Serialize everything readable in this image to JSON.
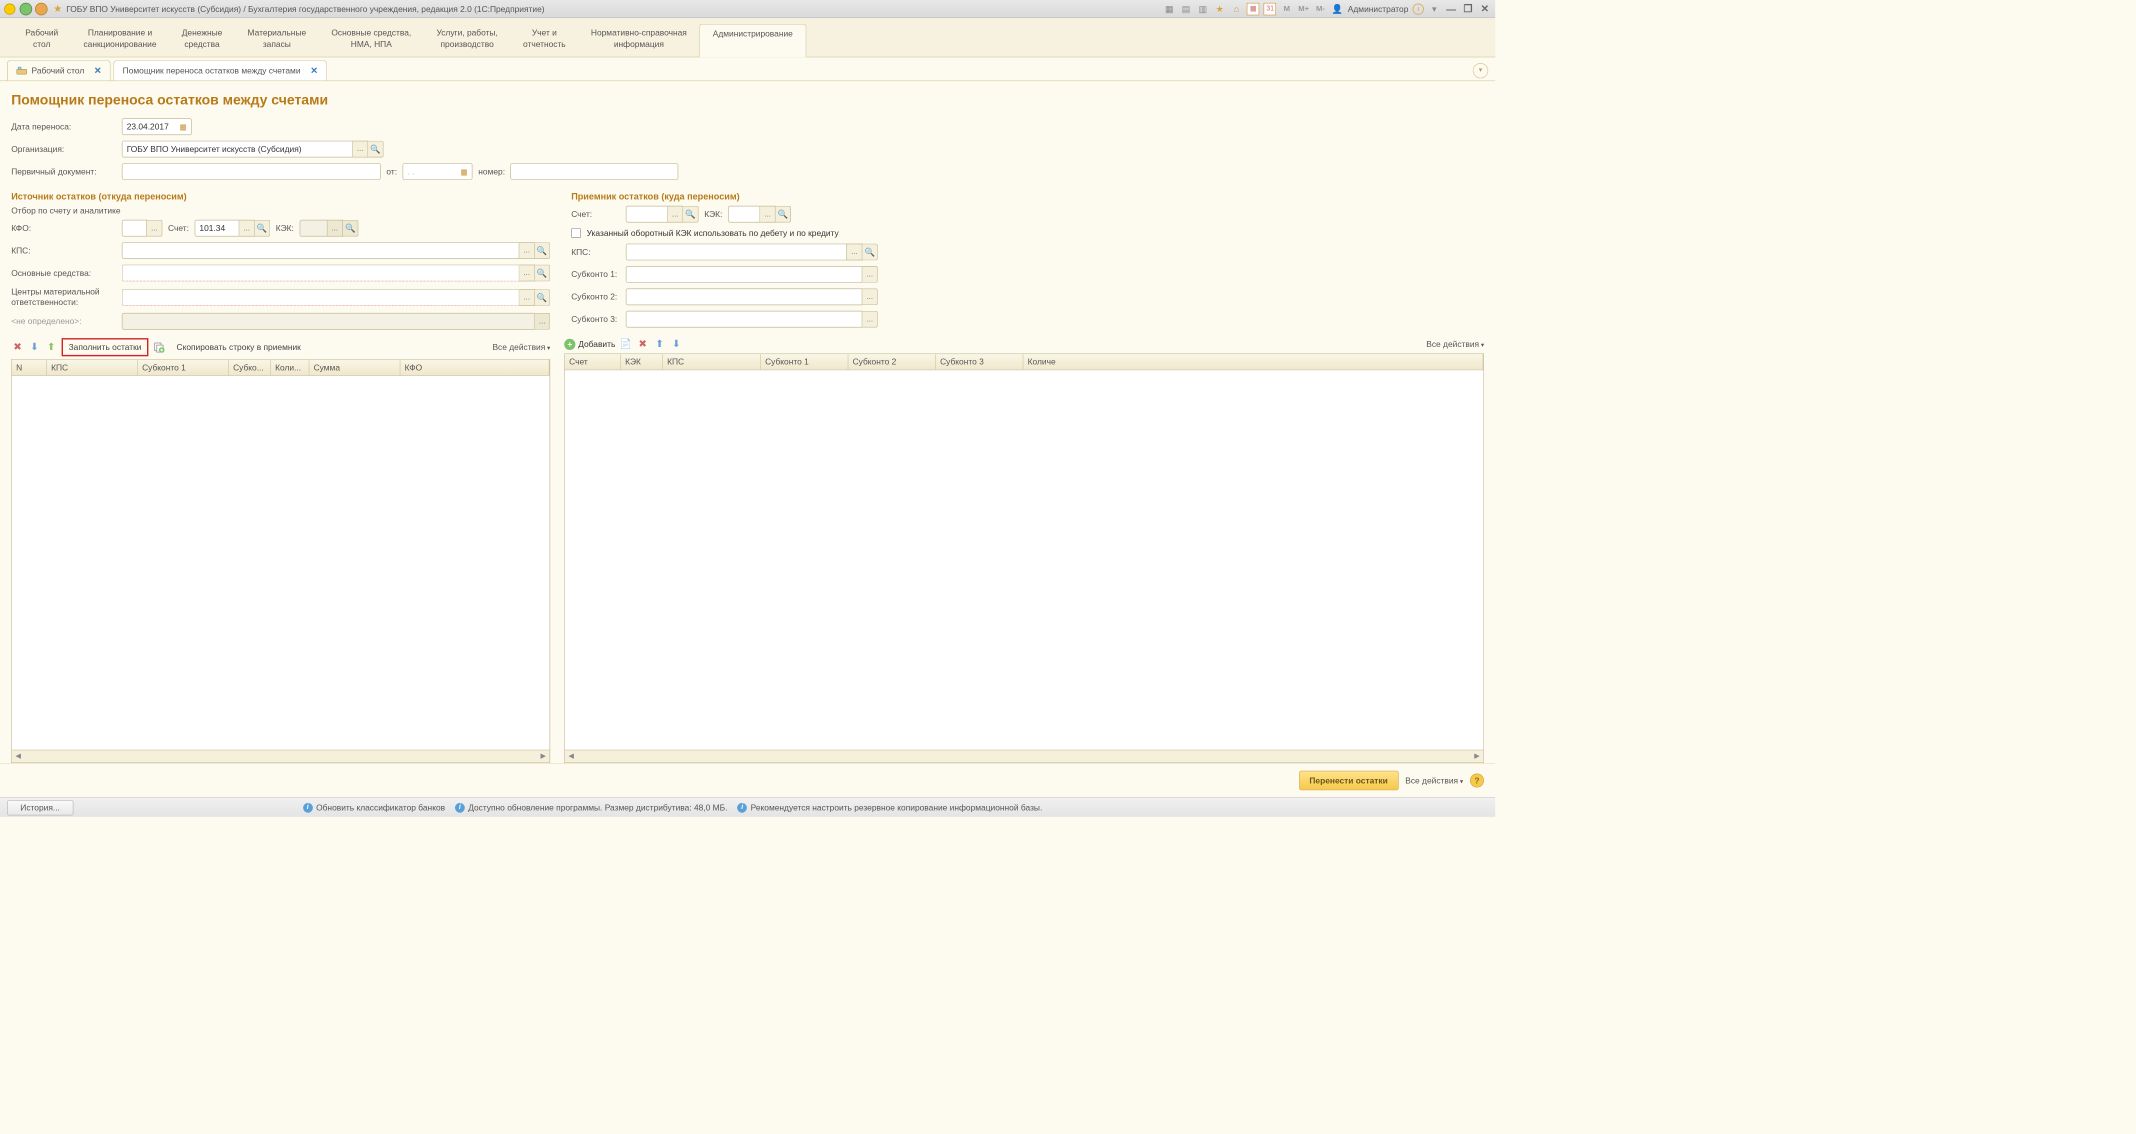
{
  "title_bar": {
    "app_title": "ГОБУ ВПО Университет искусств (Субсидия) / Бухгалтерия государственного учреждения, редакция 2.0  (1С:Предприятие)",
    "calendar_day": "31",
    "m_buttons": [
      "M",
      "M+",
      "M-"
    ],
    "user_label": "Администратор"
  },
  "main_nav": [
    "Рабочий\nстол",
    "Планирование и\nсанкционирование",
    "Денежные\nсредства",
    "Материальные\nзапасы",
    "Основные средства,\nНМА, НПА",
    "Услуги, работы,\nпроизводство",
    "Учет и\nотчетность",
    "Нормативно-справочная\nинформация",
    "Администрирование"
  ],
  "active_nav_index": 8,
  "tabs": [
    {
      "label": "Рабочий стол",
      "active": false
    },
    {
      "label": "Помощник переноса остатков между счетами",
      "active": true
    }
  ],
  "page": {
    "title": "Помощник переноса остатков между счетами",
    "labels": {
      "transfer_date": "Дата переноса:",
      "organization": "Организация:",
      "primary_doc": "Первичный документ:",
      "from": "от:",
      "number": "номер:"
    },
    "values": {
      "transfer_date": "23.04.2017",
      "organization": "ГОБУ ВПО Университет искусств (Субсидия)",
      "primary_doc": "",
      "from_date": ".  .",
      "number": ""
    },
    "source": {
      "title": "Источник остатков (откуда переносим)",
      "filter_label": "Отбор по счету и аналитике",
      "fields": {
        "kfo": "КФО:",
        "account": "Счет:",
        "kek": "КЭК:",
        "kps": "КПС:",
        "os": "Основные средства:",
        "responsibility": "Центры материальной\nответственности:",
        "undefined": "<не определено>:"
      },
      "values": {
        "kfo": "",
        "account": "101.34",
        "kek": "",
        "kps": "",
        "os": "",
        "responsibility": "",
        "undefined": ""
      }
    },
    "target": {
      "title": "Приемник остатков (куда переносим)",
      "fields": {
        "account": "Счет:",
        "kek": "КЭК:",
        "kps": "КПС:",
        "sub1": "Субконто 1:",
        "sub2": "Субконто 2:",
        "sub3": "Субконто 3:"
      },
      "checkbox_label": "Указанный оборотный КЭК использовать по дебету и по кредиту",
      "values": {
        "account": "",
        "kek": "",
        "kps": "",
        "sub1": "",
        "sub2": "",
        "sub3": ""
      }
    },
    "toolbar_left": {
      "fill": "Заполнить остатки",
      "copy": "Скопировать строку в приемник",
      "all_actions": "Все действия"
    },
    "toolbar_right": {
      "add": "Добавить",
      "all_actions": "Все действия"
    },
    "grid_left_headers": [
      "N",
      "КПС",
      "Субконто 1",
      "Субко...",
      "Коли...",
      "Сумма",
      "КФО"
    ],
    "grid_right_headers": [
      "Счет",
      "КЭК",
      "КПС",
      "Субконто 1",
      "Субконто 2",
      "Субконто 3",
      "Количе"
    ]
  },
  "footer": {
    "transfer_btn": "Перенести остатки",
    "all_actions": "Все действия"
  },
  "status_bar": {
    "history": "История...",
    "msg1": "Обновить классификатор банков",
    "msg2": "Доступно обновление программы. Размер дистрибутива: 48,0 МБ.",
    "msg3": "Рекомендуется настроить резервное копирование информационной базы."
  }
}
